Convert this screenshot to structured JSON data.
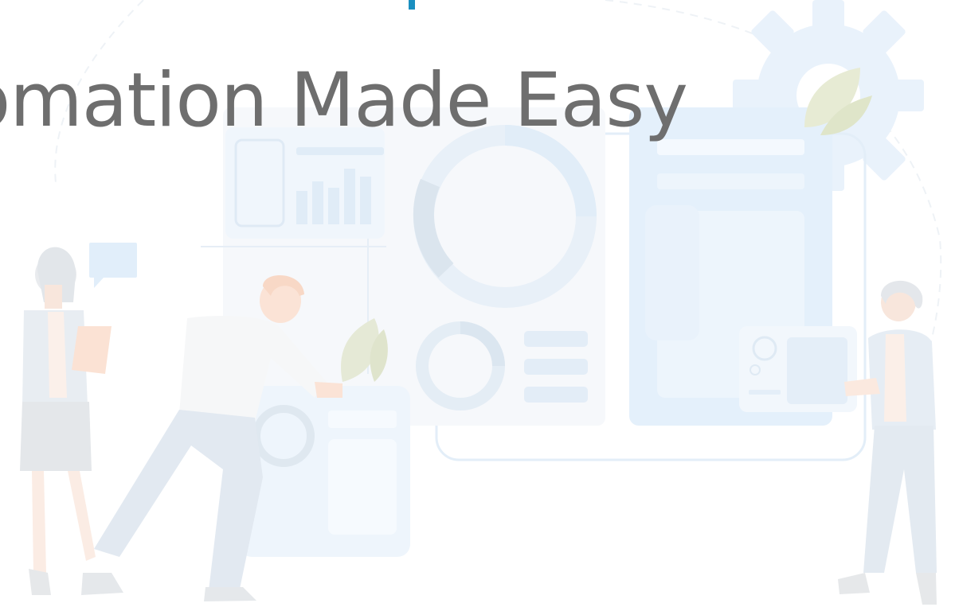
{
  "hero": {
    "headline": "omation Made Easy"
  },
  "colors": {
    "headline_text": "#6e6e6e",
    "accent": "#1a8fc0",
    "illustration_blue": "#dcecf9",
    "illustration_blue_dark": "#c4dcef",
    "illustration_grey": "#eef1f4",
    "leaf_green": "#d7dcc4",
    "skin": "#f6ddd0"
  },
  "icons": {
    "gear": "gear-icon",
    "donut": "donut-chart-icon",
    "bar_chart": "bar-chart-icon",
    "speech_bubble": "speech-bubble-icon"
  }
}
